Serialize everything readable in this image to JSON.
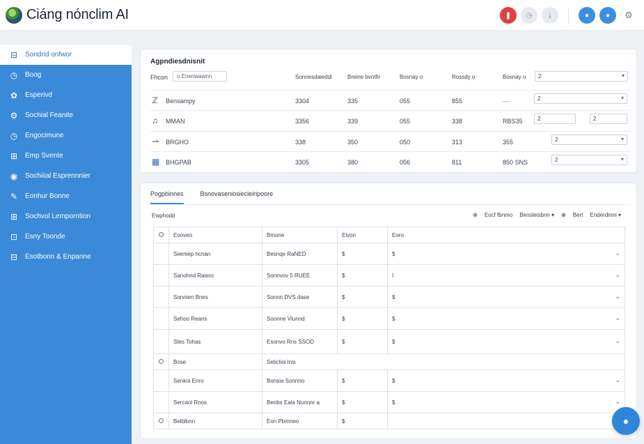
{
  "app": {
    "title": "Ciáng nónclim AI"
  },
  "topbar": {
    "icons": [
      {
        "glyph": "❚",
        "style": "red"
      },
      {
        "glyph": "◷",
        "style": "gray"
      },
      {
        "glyph": "⤓",
        "style": "gray"
      },
      {
        "glyph": "●",
        "style": "blue"
      },
      {
        "glyph": "●",
        "style": "blue"
      },
      {
        "glyph": "⚙",
        "style": "plain"
      }
    ]
  },
  "sidebar": {
    "items": [
      {
        "label": "Sondrid onfwor",
        "icon": "⊟"
      },
      {
        "label": "Boog",
        "icon": "◷"
      },
      {
        "label": "Esperivd",
        "icon": "✿"
      },
      {
        "label": "Sochial Feanite",
        "icon": "⚙"
      },
      {
        "label": "Engocimune",
        "icon": "◷"
      },
      {
        "label": "Emp Svente",
        "icon": "⊞"
      },
      {
        "label": "Sochiiial Esprennnier",
        "icon": "◉"
      },
      {
        "label": "Eonhur Bonne",
        "icon": "✎"
      },
      {
        "label": "Sochvol Lemporntion",
        "icon": "⊞"
      },
      {
        "label": "Esny Toonde",
        "icon": "⊡"
      },
      {
        "label": "Esotbonn & Enpanne",
        "icon": "⊟"
      }
    ]
  },
  "card1": {
    "title": "Agpndiesdnisnit",
    "filter_label": "Fhcon",
    "filter_value": "o   Enenwawnn",
    "columns": [
      "Sonnesdaieddi",
      "Breine bvotfir",
      "Bosnay o",
      "Rossdy o",
      "Bosnay o"
    ],
    "rows": [
      {
        "icon": "ℤ",
        "name": "Bensampy",
        "v": [
          "3304",
          "335",
          "055",
          "855"
        ],
        "extra": "—",
        "select": "2"
      },
      {
        "icon": "♫",
        "name": "MMAN",
        "v": [
          "3356",
          "339",
          "055",
          "338"
        ],
        "extra": "RBS35",
        "select": "2",
        "select2": "2"
      },
      {
        "icon": "⇀",
        "name": "BRGHO",
        "v": [
          "338",
          "350",
          "050",
          "313"
        ],
        "extra": "355",
        "select": "2"
      },
      {
        "icon": "▦",
        "name": "BHGPAB",
        "v": [
          "3305",
          "380",
          "056",
          "811"
        ],
        "extra": "850   SNS",
        "select": "2"
      }
    ],
    "top_select": "2"
  },
  "card2": {
    "tabs": [
      "Pogpbinnes",
      "Bsnovaseniosiecleiripoore"
    ],
    "section_label": "Ewphodd",
    "toolbar": [
      "⊕",
      "Eocf fbnmo",
      "Beosleisbnn ▾",
      "⊕",
      "Bert",
      "Enderdinni ▾"
    ],
    "header": [
      "Eooveo",
      "Bmone",
      "Eivon",
      "Eoro"
    ],
    "rows": [
      {
        "kind": "data",
        "c": [
          "Seeniep hcnan",
          "Besnqe RaNED",
          "$",
          "$"
        ]
      },
      {
        "kind": "data",
        "c": [
          "Sanohnd Raisnc",
          "Sonnvov 5 RUEE",
          "$",
          "I"
        ]
      },
      {
        "kind": "data",
        "c": [
          "Sonnien Bnes",
          "Sonnn DVS dase",
          "$",
          "$"
        ]
      },
      {
        "kind": "data",
        "c": [
          "Sehoo Reans",
          "Soonne Vlunnd",
          "$",
          "$"
        ]
      },
      {
        "kind": "tall",
        "c": [
          "Stes Tohas",
          "Esonvo Rns SSOD",
          "$",
          "$"
        ]
      },
      {
        "kind": "group",
        "c": [
          "Bose",
          "Seticlioi lnis"
        ]
      },
      {
        "kind": "data",
        "c": [
          "Senkoi Enro",
          "Bonsia Sonnno",
          "$",
          "$"
        ]
      },
      {
        "kind": "data",
        "c": [
          "Sercaol Rnos",
          "Beobs Eaia Nunnnr a",
          "$",
          "$"
        ]
      },
      {
        "kind": "group",
        "c": [
          "Belblbnn",
          "Eon Pbmneo",
          "$",
          ""
        ]
      }
    ]
  },
  "colors": {
    "sidebar": "#3b8ad9",
    "accent": "#2f86d9",
    "alert": "#e04146"
  },
  "fab": {
    "icon": "●"
  }
}
